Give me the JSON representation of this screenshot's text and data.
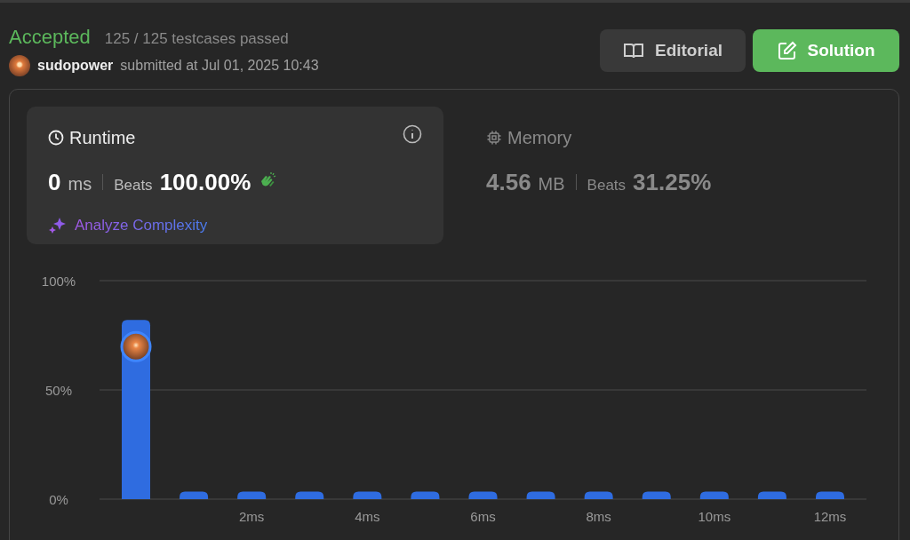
{
  "header": {
    "status": "Accepted",
    "testcases": "125 / 125 testcases passed",
    "user": "sudopower",
    "submitted": "submitted at Jul 01, 2025 10:43"
  },
  "buttons": [
    {
      "label": "Editorial",
      "kind": "secondary"
    },
    {
      "label": "Solution",
      "kind": "primary"
    }
  ],
  "metrics": [
    {
      "kind": "runtime",
      "title": "Runtime",
      "selected": true,
      "value": "0",
      "unit": "ms",
      "beats_label": "Beats",
      "beats": "100.00%",
      "link": "Analyze Complexity"
    },
    {
      "kind": "memory",
      "title": "Memory",
      "selected": false,
      "value": "4.56",
      "unit": "MB",
      "beats_label": "Beats",
      "beats": "31.25%"
    }
  ],
  "chart_data": {
    "type": "bar",
    "x": [
      0,
      1,
      2,
      3,
      4,
      5,
      6,
      7,
      8,
      9,
      10,
      11,
      12
    ],
    "values": [
      82,
      3.5,
      3.5,
      3.5,
      3.5,
      3.5,
      3.5,
      3.5,
      3.5,
      3.5,
      3.5,
      3.5,
      3.5
    ],
    "xlim": [
      -0.63,
      12.63
    ],
    "ylim": [
      0,
      100
    ],
    "yticks": [
      {
        "value": 0,
        "label": "0%"
      },
      {
        "value": 50,
        "label": "50%"
      },
      {
        "value": 100,
        "label": "100%"
      }
    ],
    "xticks": [
      {
        "value": 2,
        "label": "2ms"
      },
      {
        "value": 4,
        "label": "4ms"
      },
      {
        "value": 6,
        "label": "6ms"
      },
      {
        "value": 8,
        "label": "8ms"
      },
      {
        "value": 10,
        "label": "10ms"
      },
      {
        "value": 12,
        "label": "12ms"
      }
    ]
  }
}
